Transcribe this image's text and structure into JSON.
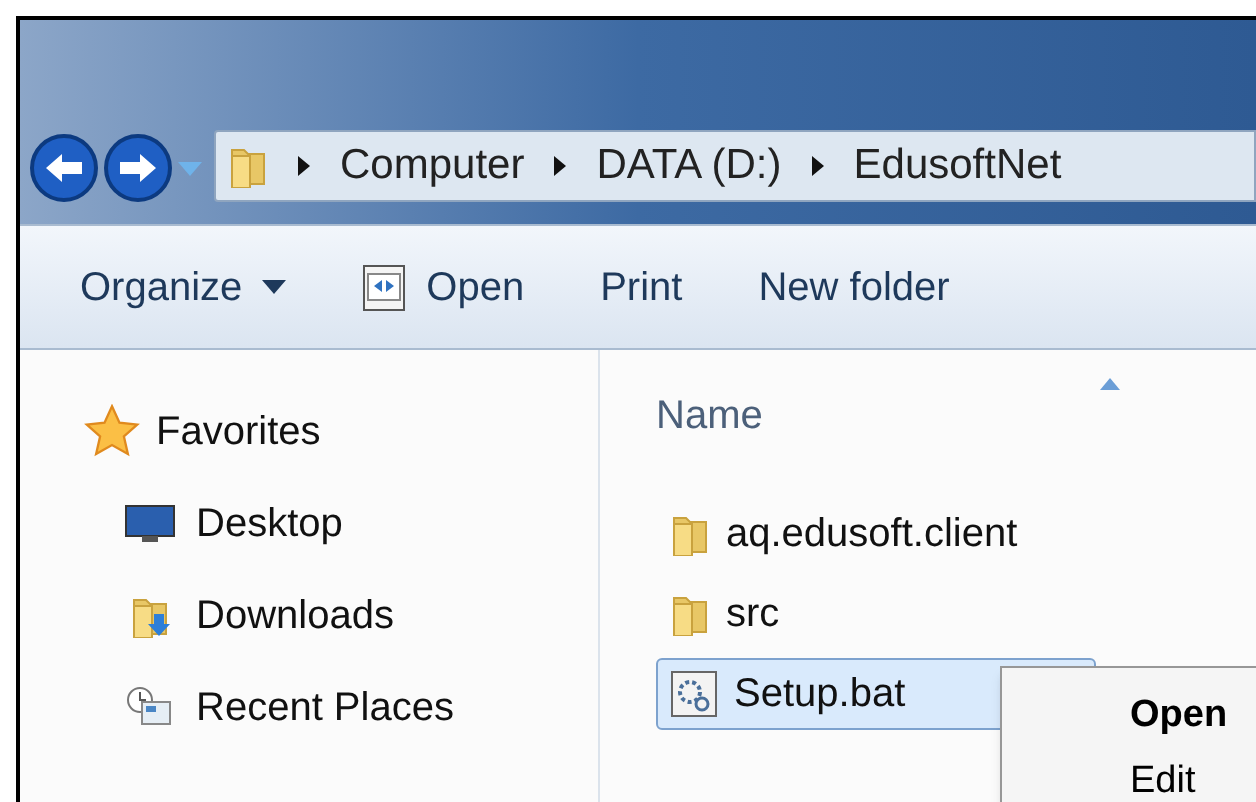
{
  "breadcrumb": [
    "Computer",
    "DATA (D:)",
    "EdusoftNet"
  ],
  "toolbar": [
    {
      "label": "Organize",
      "kind": "menu"
    },
    {
      "label": "Open",
      "kind": "icon"
    },
    {
      "label": "Print",
      "kind": "plain"
    },
    {
      "label": "New folder",
      "kind": "plain"
    }
  ],
  "sidebar": {
    "favorites": "Favorites",
    "items": [
      {
        "label": "Desktop",
        "kind": "desktop"
      },
      {
        "label": "Downloads",
        "kind": "downloads"
      },
      {
        "label": "Recent Places",
        "kind": "recent"
      }
    ]
  },
  "file_list": {
    "column": "Name",
    "rows": [
      {
        "name": "aq.edusoft.client",
        "kind": "folder",
        "selected": false
      },
      {
        "name": "src",
        "kind": "folder",
        "selected": false
      },
      {
        "name": "Setup.bat",
        "kind": "batch",
        "selected": true
      }
    ]
  },
  "context_menu": [
    {
      "label": "Open",
      "bold": true
    },
    {
      "label": "Edit",
      "bold": false
    }
  ]
}
